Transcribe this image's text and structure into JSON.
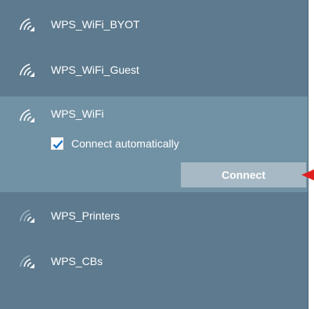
{
  "networks": [
    {
      "ssid": "WPS_WiFi_BYOT",
      "icon": "wifi-signal-icon"
    },
    {
      "ssid": "WPS_WiFi_Guest",
      "icon": "wifi-signal-icon"
    },
    {
      "ssid": "WPS_WiFi",
      "icon": "wifi-signal-icon",
      "selected": true,
      "connect_automatically_label": "Connect automatically",
      "connect_automatically_checked": true,
      "connect_label": "Connect"
    },
    {
      "ssid": "WPS_Printers",
      "icon": "wifi-signal-icon"
    },
    {
      "ssid": "WPS_CBs",
      "icon": "wifi-signal-icon"
    }
  ],
  "colors": {
    "panel_background": "#5d7a8e",
    "selected_background": "#7191a4",
    "button_background": "#a6b9c4",
    "checkbox_check": "#1a73c8",
    "arrow": "#e02020"
  }
}
